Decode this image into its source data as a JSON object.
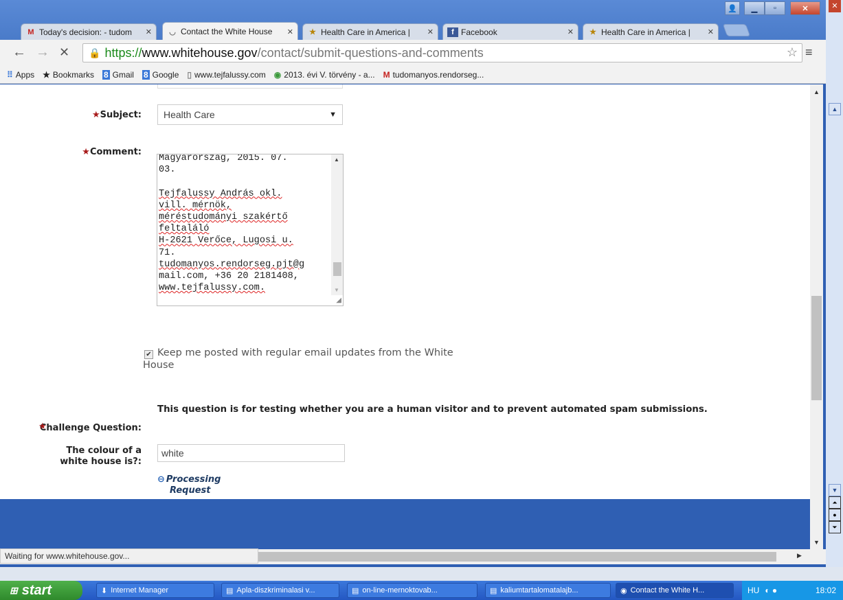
{
  "browser": {
    "tabs": [
      {
        "label": "Today's decision: - tudom",
        "icon": "gmail-icon"
      },
      {
        "label": "Contact the White House",
        "icon": "loading-icon"
      },
      {
        "label": "Health Care in America |",
        "icon": "whitehouse-seal-icon"
      },
      {
        "label": "Facebook",
        "icon": "facebook-icon"
      },
      {
        "label": "Health Care in America |",
        "icon": "whitehouse-seal-icon"
      }
    ],
    "url_scheme": "https://",
    "url_host": "www.whitehouse.gov",
    "url_path": "/contact/submit-questions-and-comments",
    "bookmarks": [
      {
        "label": "Apps",
        "icon": "apps-icon"
      },
      {
        "label": "Bookmarks",
        "icon": "star-icon"
      },
      {
        "label": "Gmail",
        "icon": "google-plus-icon"
      },
      {
        "label": "Google",
        "icon": "google-plus-icon"
      },
      {
        "label": "www.tejfalussy.com",
        "icon": "page-icon"
      },
      {
        "label": "2013. évi V. törvény - a...",
        "icon": "globe-icon"
      },
      {
        "label": "tudomanyos.rendorseg...",
        "icon": "gmail-icon"
      }
    ],
    "status_text": "Waiting for www.whitehouse.gov..."
  },
  "form": {
    "subject_label": "Subject:",
    "subject_value": "Health Care",
    "comment_label": "Comment:",
    "comment_lines": [
      {
        "text": "Magyarország, 2015. 07.",
        "ul": false
      },
      {
        "text": "03.",
        "ul": false
      },
      {
        "text": "",
        "ul": false
      },
      {
        "text": "Tejfalussy András okl.",
        "ul": true
      },
      {
        "text": "vill. mérnök,",
        "ul": true
      },
      {
        "text": "méréstudományi szakértő",
        "ul": true
      },
      {
        "text": "feltaláló",
        "ul": true
      },
      {
        "text": "H-2621 Verőce, Lugosi u.",
        "ul": true
      },
      {
        "text": "71.",
        "ul": false
      },
      {
        "text": "tudomanyos.rendorseg.pjt@g",
        "ul": true
      },
      {
        "text": "mail.com, +36 20 2181408,",
        "ul": false
      },
      {
        "text": "www.tejfalussy.com.",
        "ul": true
      }
    ],
    "keep_posted_label": "Keep me posted with regular email updates from the White House",
    "keep_posted_checked": true,
    "challenge_description": "This question is for testing whether you are a human visitor and to prevent automated spam submissions.",
    "challenge_label": "Challenge Question:",
    "colour_question_line1": "The colour of a",
    "colour_question_line2": "white house is?:",
    "colour_answer": "white",
    "processing_line1": "Processing",
    "processing_line2": "Request"
  },
  "footer": {
    "icons": [
      "twitter-icon",
      "instagram-icon",
      "facebook-icon",
      "google-plus-icon",
      "youtube-icon",
      "plus-icon",
      "chat-icon",
      "email-icon"
    ]
  },
  "taskbar": {
    "start_label": "start",
    "items": [
      {
        "label": "Internet Manager"
      },
      {
        "label": "Apla-diszkriminalasi v..."
      },
      {
        "label": "on-line-mernoktovab..."
      },
      {
        "label": "kaliumtartalomatalajb..."
      },
      {
        "label": "Contact the White H..."
      }
    ],
    "language": "HU",
    "clock": "18:02"
  }
}
